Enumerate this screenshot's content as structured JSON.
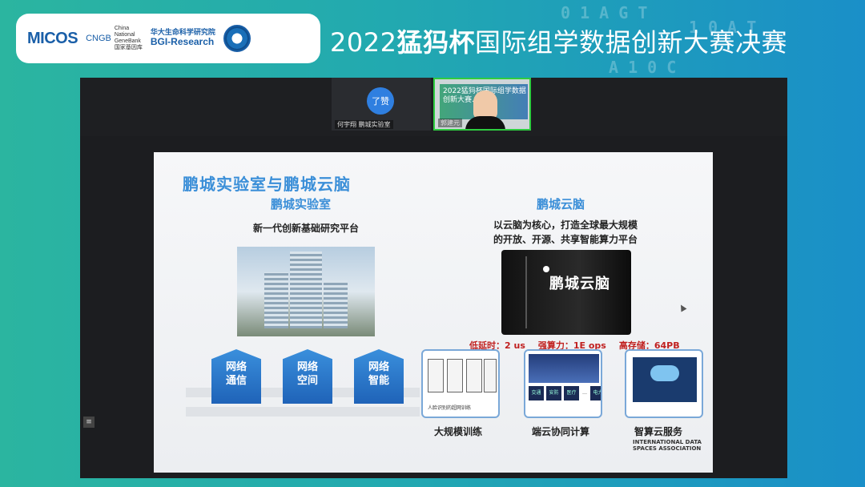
{
  "header": {
    "logos": {
      "micos": "MICOS",
      "cngb_mark": "CNGB",
      "cngb_lines": [
        "China",
        "National",
        "GeneBank",
        "国家基因库"
      ],
      "bgi_cn": "华大生命科学研究院",
      "bgi_en": "BGI-Research"
    },
    "title_prefix": "2022",
    "title_bold": "猛犸杯",
    "title_suffix": "国际组学数据创新大赛决赛"
  },
  "video": {
    "participants": [
      {
        "avatar_text": "了赞",
        "label": "何宇翔 鹏城实验室"
      },
      {
        "label": "郭建元",
        "poster_text": [
          "2022猛犸杯国际组学数据",
          "创新大赛..."
        ]
      }
    ],
    "dock_icon": "menu-icon"
  },
  "slide": {
    "title": "鹏城实验室与鹏城云脑",
    "left_heading": "鹏城实验室",
    "left_subtitle": "新一代创新基础研究平台",
    "pillars": [
      "网络\n通信",
      "网络\n空间",
      "网络\n智能"
    ],
    "right_heading": "鹏城云脑",
    "right_desc": [
      "以云脑为核心，打造全球最大规模",
      "的开放、开源、共享智能算力平台"
    ],
    "server_label": "鹏城云脑",
    "specs": [
      "低延时：2 us",
      "强算力：1E ops",
      "高存储：64PB"
    ],
    "captions": [
      "大规模训练",
      "端云协同计算",
      "智算云服务"
    ],
    "box1_footer": "人脸识别的超网训练",
    "box2_tiles": [
      "交通",
      "安防",
      "医疗",
      "…",
      "电力"
    ],
    "footer_logo": [
      "INTERNATIONAL DATA",
      "SPACES ASSOCIATION"
    ]
  },
  "colors": {
    "accent_blue": "#3b8fd8",
    "spec_red": "#c0201f",
    "cam_border": "#2ecc40"
  }
}
